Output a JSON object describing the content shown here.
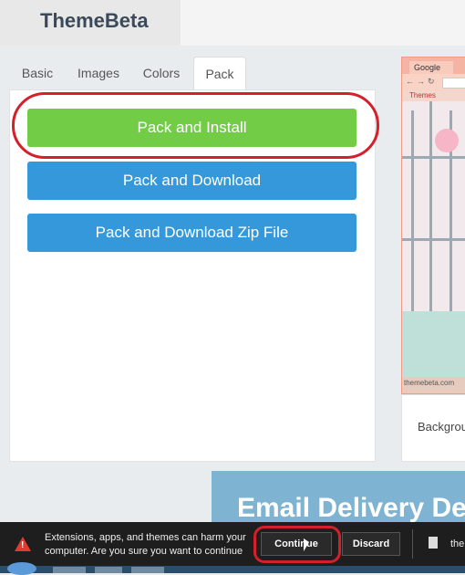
{
  "header": {
    "logo": "ThemeBeta"
  },
  "tabs": [
    {
      "label": "Basic"
    },
    {
      "label": "Images"
    },
    {
      "label": "Colors"
    },
    {
      "label": "Pack"
    }
  ],
  "pack_panel": {
    "install_label": "Pack and Install",
    "download_label": "Pack and Download",
    "zip_label": "Pack and Download Zip File"
  },
  "preview": {
    "tab_label": "Google",
    "bookmark": "Themes",
    "credit": "themebeta.com",
    "background_label": "Backgrou"
  },
  "ad": {
    "text": "Email Delivery De"
  },
  "download_bar": {
    "message": "Extensions, apps, and themes can harm your computer. Are you sure you want to continue",
    "continue_label": "Continue",
    "discard_label": "Discard",
    "file_name": "the"
  },
  "colors": {
    "accent_green": "#72cc46",
    "accent_blue": "#3498db",
    "highlight": "#d4202a"
  }
}
